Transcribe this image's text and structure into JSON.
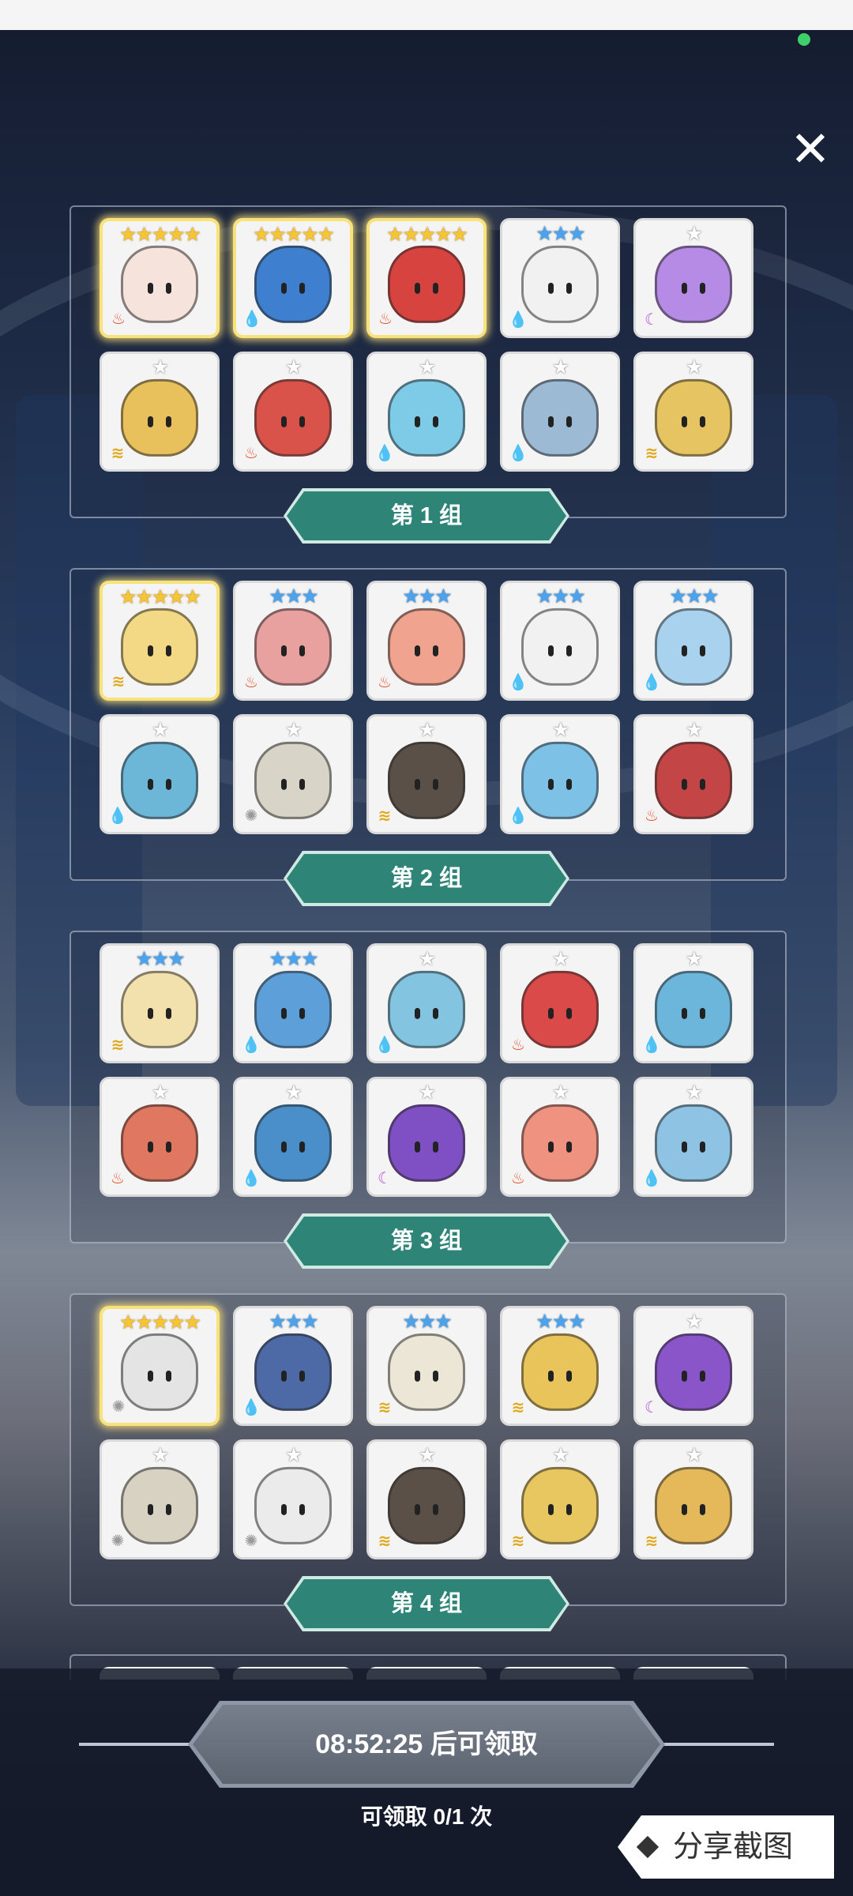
{
  "header": {
    "close_label": "✕"
  },
  "groups": [
    {
      "title": "第 1 组",
      "cards": [
        {
          "stars": 5,
          "tier": "gold",
          "element": "fire",
          "legendary": true,
          "color": "#f5e3dc"
        },
        {
          "stars": 5,
          "tier": "gold",
          "element": "water",
          "legendary": true,
          "color": "#3f7fcf"
        },
        {
          "stars": 5,
          "tier": "gold",
          "element": "fire",
          "legendary": true,
          "color": "#d7443f"
        },
        {
          "stars": 3,
          "tier": "blue",
          "element": "water",
          "color": "#f1f1f1"
        },
        {
          "stars": 1,
          "tier": "gray",
          "element": "dark",
          "color": "#b68be6"
        },
        {
          "stars": 1,
          "tier": "gray",
          "element": "wind",
          "color": "#e8c15c"
        },
        {
          "stars": 1,
          "tier": "gray",
          "element": "fire",
          "color": "#d9534a"
        },
        {
          "stars": 1,
          "tier": "gray",
          "element": "water",
          "color": "#7ecbe8"
        },
        {
          "stars": 1,
          "tier": "gray",
          "element": "water",
          "color": "#9dbad4"
        },
        {
          "stars": 1,
          "tier": "gray",
          "element": "wind",
          "color": "#e6c461"
        }
      ]
    },
    {
      "title": "第 2 组",
      "cards": [
        {
          "stars": 5,
          "tier": "gold",
          "element": "wind",
          "legendary": true,
          "color": "#f3d985"
        },
        {
          "stars": 3,
          "tier": "blue",
          "element": "fire",
          "color": "#e9a1a0"
        },
        {
          "stars": 3,
          "tier": "blue",
          "element": "fire",
          "color": "#f0a38f"
        },
        {
          "stars": 3,
          "tier": "blue",
          "element": "water",
          "color": "#f1f1f1"
        },
        {
          "stars": 3,
          "tier": "blue",
          "element": "water",
          "color": "#a9d2ef"
        },
        {
          "stars": 1,
          "tier": "gray",
          "element": "water",
          "color": "#6cb6d8"
        },
        {
          "stars": 1,
          "tier": "gray",
          "element": "light",
          "color": "#d8d4c8"
        },
        {
          "stars": 1,
          "tier": "gray",
          "element": "wind",
          "color": "#5b5048"
        },
        {
          "stars": 1,
          "tier": "gray",
          "element": "water",
          "color": "#7ec1e6"
        },
        {
          "stars": 1,
          "tier": "gray",
          "element": "fire",
          "color": "#c44545"
        }
      ]
    },
    {
      "title": "第 3 组",
      "cards": [
        {
          "stars": 3,
          "tier": "blue",
          "element": "wind",
          "color": "#f3e1ad"
        },
        {
          "stars": 3,
          "tier": "blue",
          "element": "water",
          "color": "#5d9fd8"
        },
        {
          "stars": 1,
          "tier": "gray",
          "element": "water",
          "color": "#83c4e1"
        },
        {
          "stars": 1,
          "tier": "gray",
          "element": "fire",
          "color": "#d94a49"
        },
        {
          "stars": 1,
          "tier": "gray",
          "element": "water",
          "color": "#6db6db"
        },
        {
          "stars": 1,
          "tier": "gray",
          "element": "fire",
          "color": "#e07761"
        },
        {
          "stars": 1,
          "tier": "gray",
          "element": "water",
          "color": "#4a8fc9"
        },
        {
          "stars": 1,
          "tier": "gray",
          "element": "dark",
          "color": "#7f4fc4"
        },
        {
          "stars": 1,
          "tier": "gray",
          "element": "fire",
          "color": "#ef9380"
        },
        {
          "stars": 1,
          "tier": "gray",
          "element": "water",
          "color": "#8fc3e3"
        }
      ]
    },
    {
      "title": "第 4 组",
      "cards": [
        {
          "stars": 5,
          "tier": "gold",
          "element": "light",
          "legendary": true,
          "color": "#e4e4e4"
        },
        {
          "stars": 3,
          "tier": "blue",
          "element": "water",
          "color": "#4d6aa6"
        },
        {
          "stars": 3,
          "tier": "blue",
          "element": "wind",
          "color": "#ece6d6"
        },
        {
          "stars": 3,
          "tier": "blue",
          "element": "wind",
          "color": "#e8c45a"
        },
        {
          "stars": 1,
          "tier": "gray",
          "element": "dark",
          "color": "#8a55c8"
        },
        {
          "stars": 1,
          "tier": "gray",
          "element": "light",
          "color": "#d8d2c2"
        },
        {
          "stars": 1,
          "tier": "gray",
          "element": "light",
          "color": "#ebebeb"
        },
        {
          "stars": 1,
          "tier": "gray",
          "element": "wind",
          "color": "#5b5048"
        },
        {
          "stars": 1,
          "tier": "gray",
          "element": "wind",
          "color": "#e8c660"
        },
        {
          "stars": 1,
          "tier": "gray",
          "element": "wind",
          "color": "#e5b95a"
        }
      ]
    }
  ],
  "footer": {
    "claim_label": "08:52:25 后可领取",
    "claim_count": "可领取 0/1 次",
    "share_label": "分享截图"
  },
  "icons": {
    "star": "★",
    "fire": "♨",
    "water": "💧",
    "wind": "≋",
    "light": "✺",
    "dark": "☾"
  }
}
